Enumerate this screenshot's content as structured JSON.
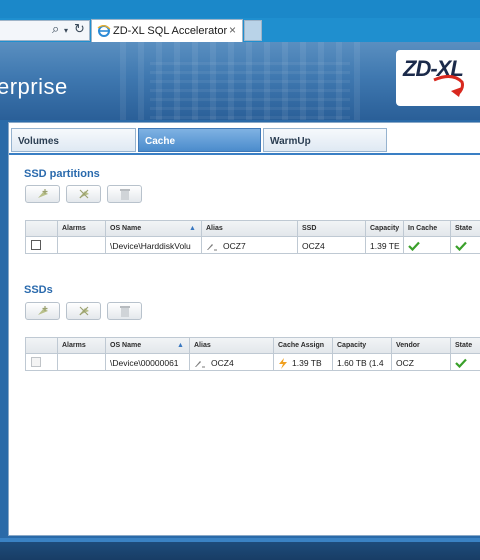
{
  "browser": {
    "address_glyphs": [
      "⌕",
      "▾",
      "↻"
    ],
    "tab_title": "ZD-XL SQL Accelerator",
    "tab_close": "×"
  },
  "header": {
    "brand_text": "erprise",
    "logo_text": "ZD-XL"
  },
  "tabs": [
    {
      "label": "Volumes",
      "active": false
    },
    {
      "label": "Cache",
      "active": true
    },
    {
      "label": "WarmUp",
      "active": false
    }
  ],
  "ssd_partitions": {
    "title": "SSD partitions",
    "toolbar": [
      "add-partition-icon",
      "remove-partition-icon",
      "delete-icon"
    ],
    "columns": [
      "",
      "Alarms",
      "OS Name",
      "Alias",
      "SSD",
      "Capacity",
      "In Cache",
      "State"
    ],
    "rows": [
      {
        "alarms": "",
        "os_name": "\\Device\\HarddiskVolu",
        "alias": "OCZ7",
        "ssd": "OCZ4",
        "capacity": "1.39 TE",
        "in_cache": "check",
        "state": "check"
      }
    ]
  },
  "ssds": {
    "title": "SSDs",
    "toolbar": [
      "add-ssd-icon",
      "remove-ssd-icon",
      "delete-icon"
    ],
    "columns": [
      "",
      "Alarms",
      "OS Name",
      "Alias",
      "Cache Assign",
      "Capacity",
      "Vendor",
      "State"
    ],
    "rows": [
      {
        "alarms": "",
        "os_name": "\\Device\\00000061",
        "alias": "OCZ4",
        "cache_assign": "1.39 TB",
        "capacity": "1.60 TB (1.4",
        "vendor": "OCZ",
        "state": "check"
      }
    ]
  },
  "colors": {
    "accent": "#2a6aad",
    "tab_active": "#4b8ccc",
    "check": "#3aa02a",
    "bolt": "#f0a020"
  }
}
